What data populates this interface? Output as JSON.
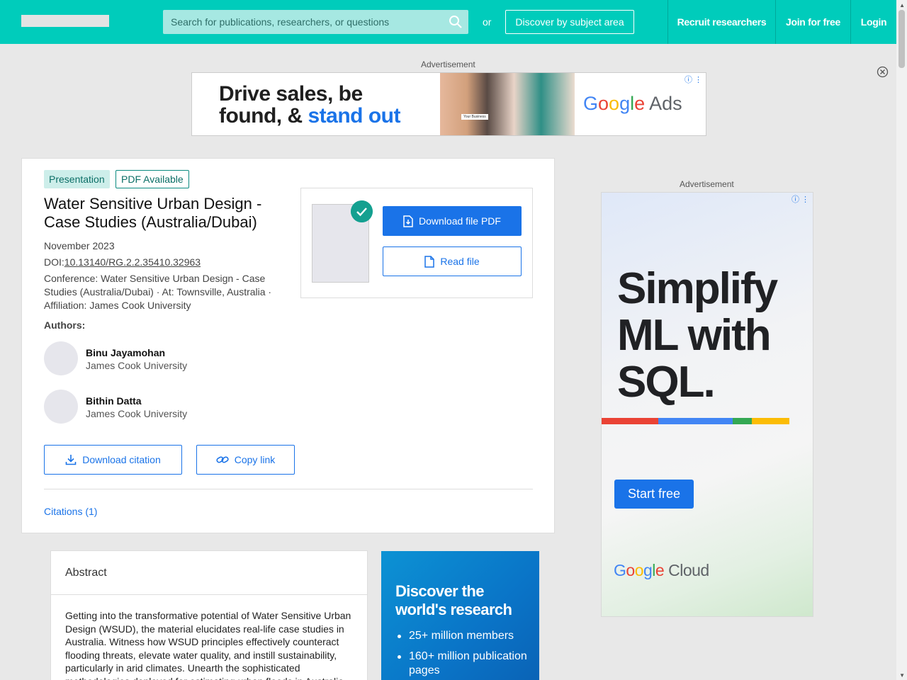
{
  "header": {
    "search_placeholder": "Search for publications, researchers, or questions",
    "or_text": "or",
    "discover_label": "Discover by subject area",
    "nav": [
      "Recruit researchers",
      "Join for free",
      "Login"
    ]
  },
  "ads": {
    "label": "Advertisement",
    "top": {
      "headline_line1": "Drive sales, be",
      "headline_line2a": "found, & ",
      "headline_line2b": "stand out",
      "photo_caption": "Your Business",
      "brand_g": "G",
      "brand_o1": "o",
      "brand_o2": "o",
      "brand_g2": "g",
      "brand_l": "l",
      "brand_e": "e",
      "brand_suffix": " Ads"
    },
    "side": {
      "headline": "Simplify ML with SQL.",
      "cta": "Start free",
      "brand_g": "G",
      "brand_o1": "o",
      "brand_o2": "o",
      "brand_g2": "g",
      "brand_l": "l",
      "brand_e": "e",
      "brand_suffix": " Cloud"
    }
  },
  "publication": {
    "type_tag": "Presentation",
    "pdf_tag": "PDF Available",
    "title": "Water Sensitive Urban Design - Case Studies (Australia/Dubai)",
    "date": "November 2023",
    "doi_prefix": "DOI:",
    "doi": "10.13140/RG.2.2.35410.32963",
    "conference": "Conference: Water Sensitive Urban Design - Case Studies (Australia/Dubai) · At: Townsville, Australia · Affiliation: James Cook University",
    "authors_label": "Authors:",
    "authors": [
      {
        "name": "Binu Jayamohan",
        "affiliation": "James Cook University"
      },
      {
        "name": "Bithin Datta",
        "affiliation": "James Cook University"
      }
    ],
    "download_pdf": "Download file PDF",
    "read_file": "Read file",
    "download_citation": "Download citation",
    "copy_link": "Copy link",
    "citations_tab": "Citations (1)"
  },
  "abstract": {
    "heading": "Abstract",
    "text": "Getting into the transformative potential of Water Sensitive Urban Design (WSUD), the material elucidates real-life case studies in Australia. Witness how WSUD principles effectively counteract flooding threats, elevate water quality, and instill sustainability, particularly in arid climates. Unearth the sophisticated methodologies deployed for estimating urban floods in Australia"
  },
  "promo": {
    "title": "Discover the world's research",
    "items": [
      "25+ million members",
      "160+ million publication pages"
    ]
  },
  "colors": {
    "brand_teal": "#00ccbb",
    "primary_blue": "#1a73e8"
  }
}
